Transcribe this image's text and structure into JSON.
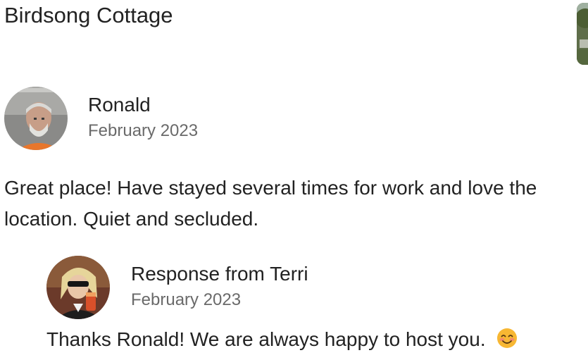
{
  "listing": {
    "title": "Birdsong Cottage",
    "thumbnail_icon": "listing-photo"
  },
  "review": {
    "reviewer_name": "Ronald",
    "reviewer_avatar": "reviewer-avatar-photo",
    "date": "February 2023",
    "text_line1": "Great place! Have stayed several times for work and love the",
    "text_line2": "location. Quiet and secluded."
  },
  "response": {
    "heading": "Response from Terri",
    "host_avatar": "host-avatar-photo",
    "date": "February 2023",
    "text": "Thanks Ronald! We are always happy to host you.",
    "emoji_icon": "smiling-face-emoji"
  }
}
